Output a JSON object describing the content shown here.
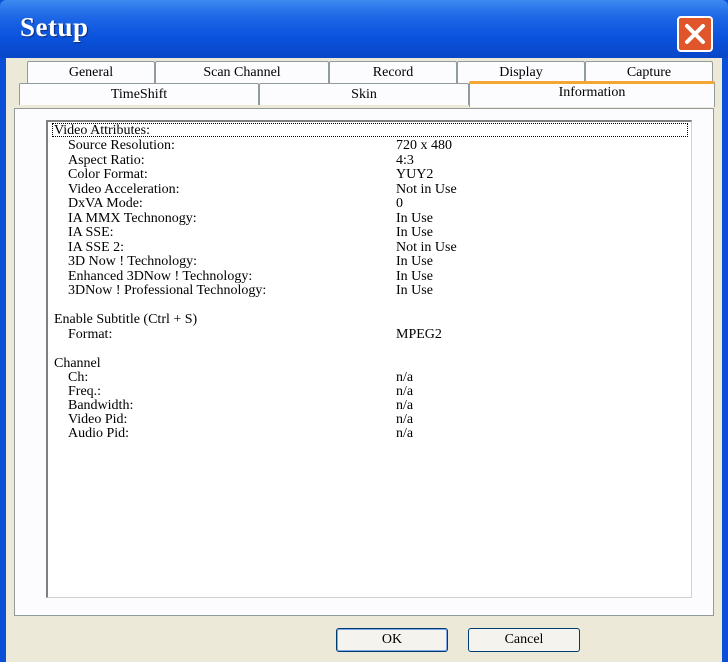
{
  "window": {
    "title": "Setup"
  },
  "tabs": {
    "row1": [
      "General",
      "Scan Channel",
      "Record",
      "Display",
      "Capture"
    ],
    "row2": [
      "TimeShift",
      "Skin",
      "Information"
    ]
  },
  "video": {
    "header": "Video Attributes:",
    "items": [
      {
        "label": "Source Resolution:",
        "value": "720 x 480"
      },
      {
        "label": "Aspect Ratio:",
        "value": "4:3"
      },
      {
        "label": "Color Format:",
        "value": "YUY2"
      },
      {
        "label": "Video Acceleration:",
        "value": "Not in Use"
      },
      {
        "label": "DxVA Mode:",
        "value": "0"
      },
      {
        "label": "IA MMX Technonogy:",
        "value": "In Use"
      },
      {
        "label": "IA SSE:",
        "value": "In Use"
      },
      {
        "label": "IA SSE 2:",
        "value": "Not in Use"
      },
      {
        "label": "3D Now ! Technology:",
        "value": "In Use"
      },
      {
        "label": "Enhanced 3DNow ! Technology:",
        "value": "In Use"
      },
      {
        "label": "3DNow ! Professional Technology:",
        "value": "In Use"
      }
    ]
  },
  "subtitle": {
    "header": "Enable Subtitle (Ctrl + S)",
    "format_label": "Format:",
    "format_value": "MPEG2"
  },
  "channel": {
    "header": "Channel",
    "items": [
      {
        "label": "Ch:",
        "value": "n/a"
      },
      {
        "label": "Freq.:",
        "value": "n/a"
      },
      {
        "label": "Bandwidth:",
        "value": "n/a"
      },
      {
        "label": "Video Pid:",
        "value": "n/a"
      },
      {
        "label": "Audio Pid:",
        "value": "n/a"
      }
    ]
  },
  "buttons": {
    "ok": "OK",
    "cancel": "Cancel"
  }
}
